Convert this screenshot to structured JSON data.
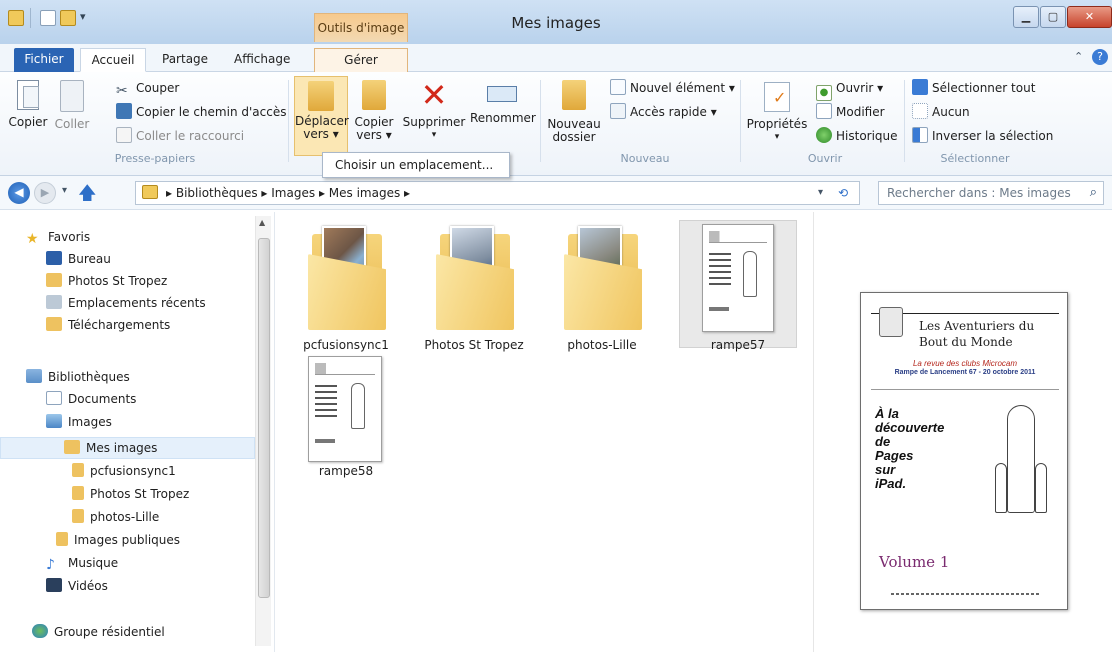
{
  "window": {
    "title": "Mes images",
    "context_tab": "Outils d'image"
  },
  "tabs": {
    "fichier": "Fichier",
    "accueil": "Accueil",
    "partage": "Partage",
    "affichage": "Affichage",
    "gerer": "Gérer"
  },
  "ribbon": {
    "copier": "Copier",
    "coller": "Coller",
    "couper": "Couper",
    "copier_chemin": "Copier le chemin d'accès",
    "coller_raccourci": "Coller le raccourci",
    "deplacer_1": "Déplacer",
    "deplacer_2": "vers ▾",
    "copier_vers_1": "Copier",
    "copier_vers_2": "vers ▾",
    "supprimer": "Supprimer",
    "renommer": "Renommer",
    "nouveau_dossier_1": "Nouveau",
    "nouveau_dossier_2": "dossier",
    "nouvel_element": "Nouvel élément ▾",
    "acces_rapide": "Accès rapide ▾",
    "proprietes": "Propriétés",
    "ouvrir": "Ouvrir ▾",
    "modifier": "Modifier",
    "historique": "Historique",
    "selectionner_tout": "Sélectionner tout",
    "aucun": "Aucun",
    "inverser": "Inverser la sélection",
    "groups": {
      "presse_papiers": "Presse-papiers",
      "nouveau": "Nouveau",
      "ouvrir": "Ouvrir",
      "selectionner": "Sélectionner"
    },
    "dropdown_item": "Choisir un emplacement..."
  },
  "address": {
    "path": [
      "Bibliothèques",
      "Images",
      "Mes images"
    ],
    "search_placeholder": "Rechercher dans : Mes images"
  },
  "nav": {
    "favoris": "Favoris",
    "bureau": "Bureau",
    "photos_st_tropez": "Photos St Tropez",
    "emplacements_recents": "Emplacements récents",
    "telechargements": "Téléchargements",
    "bibliotheques": "Bibliothèques",
    "documents": "Documents",
    "images": "Images",
    "mes_images": "Mes images",
    "pcfusionsync1": "pcfusionsync1",
    "photos_st_tropez_2": "Photos St Tropez",
    "photos_lille": "photos-Lille",
    "images_publiques": "Images publiques",
    "musique": "Musique",
    "videos": "Vidéos",
    "groupe_residentiel": "Groupe résidentiel"
  },
  "files": [
    {
      "name": "pcfusionsync1",
      "type": "folder"
    },
    {
      "name": "Photos St Tropez",
      "type": "folder"
    },
    {
      "name": "photos-Lille",
      "type": "folder"
    },
    {
      "name": "rampe57",
      "type": "document",
      "selected": true
    },
    {
      "name": "rampe58",
      "type": "document"
    }
  ],
  "preview": {
    "title_1": "Les Aventuriers du",
    "title_2": "Bout du Monde",
    "subtitle": "La revue des clubs Microcam",
    "rampe": "Rampe de Lancement 67 - 20 octobre 2011",
    "headline": [
      "À la",
      "découverte",
      "de",
      "Pages",
      "sur",
      "iPad."
    ],
    "volume": "Volume 1"
  }
}
